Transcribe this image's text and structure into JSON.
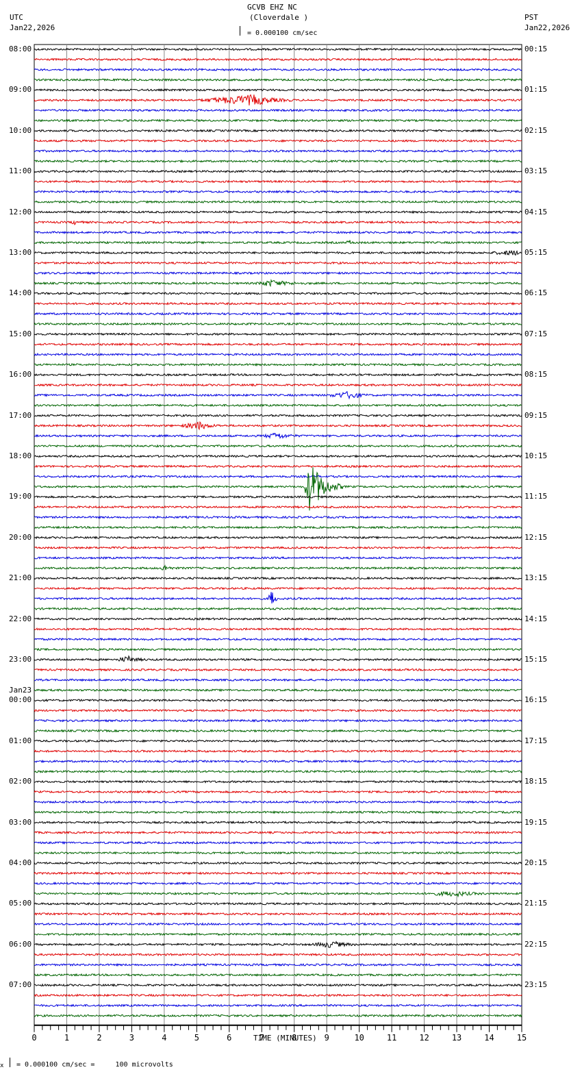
{
  "header": {
    "title": "GCVB EHZ NC",
    "location": "(Cloverdale )",
    "scale": "= 0.000100 cm/sec",
    "left_tz": "UTC",
    "left_date": "Jan22,2026",
    "right_tz": "PST",
    "right_date": "Jan22,2026"
  },
  "footer": {
    "scale_note": "= 0.000100 cm/sec =     100 microvolts",
    "scale_prefix": "x"
  },
  "chart_data": {
    "type": "line",
    "title": "GCVB EHZ NC (Cloverdale )",
    "xlabel": "TIME (MINUTES)",
    "xlim": [
      0,
      15
    ],
    "x_ticks": [
      "0",
      "1",
      "2",
      "3",
      "4",
      "5",
      "6",
      "7",
      "8",
      "9",
      "10",
      "11",
      "12",
      "13",
      "14",
      "15"
    ],
    "grid": true,
    "traces_per_hour": 4,
    "trace_colors": [
      "#000000",
      "#e00000",
      "#0000e0",
      "#006400"
    ],
    "utc_labels": [
      "08:00",
      "09:00",
      "10:00",
      "11:00",
      "12:00",
      "13:00",
      "14:00",
      "15:00",
      "16:00",
      "17:00",
      "18:00",
      "19:00",
      "20:00",
      "21:00",
      "22:00",
      "23:00",
      "00:00",
      "01:00",
      "02:00",
      "03:00",
      "04:00",
      "05:00",
      "06:00",
      "07:00"
    ],
    "date_change_label": "Jan23",
    "pst_labels": [
      "00:15",
      "01:15",
      "02:15",
      "03:15",
      "04:15",
      "05:15",
      "06:15",
      "07:15",
      "08:15",
      "09:15",
      "10:15",
      "11:15",
      "12:15",
      "13:15",
      "14:15",
      "15:15",
      "16:15",
      "17:15",
      "18:15",
      "19:15",
      "20:15",
      "21:15",
      "22:15",
      "23:15"
    ],
    "events": [
      {
        "trace": 5,
        "start": 5.0,
        "peak": 6.8,
        "end": 8.0,
        "amp": 7
      },
      {
        "trace": 17,
        "start": 1.1,
        "peak": 1.3,
        "end": 1.5,
        "amp": 3
      },
      {
        "trace": 19,
        "start": 9.6,
        "peak": 9.7,
        "end": 9.9,
        "amp": 3
      },
      {
        "trace": 20,
        "start": 14.0,
        "peak": 14.8,
        "end": 15.0,
        "amp": 3
      },
      {
        "trace": 23,
        "start": 6.8,
        "peak": 7.3,
        "end": 8.5,
        "amp": 4
      },
      {
        "trace": 34,
        "start": 9.0,
        "peak": 9.8,
        "end": 10.3,
        "amp": 5
      },
      {
        "trace": 38,
        "start": 7.0,
        "peak": 7.5,
        "end": 8.2,
        "amp": 4
      },
      {
        "trace": 37,
        "start": 4.5,
        "peak": 5.1,
        "end": 5.8,
        "amp": 5
      },
      {
        "trace": 43,
        "start": 8.3,
        "peak": 8.5,
        "end": 9.5,
        "amp": 40
      },
      {
        "trace": 51,
        "start": 3.9,
        "peak": 4.0,
        "end": 4.3,
        "amp": 5
      },
      {
        "trace": 54,
        "start": 7.2,
        "peak": 7.3,
        "end": 7.5,
        "amp": 16
      },
      {
        "trace": 60,
        "start": 2.5,
        "peak": 2.9,
        "end": 3.5,
        "amp": 4
      },
      {
        "trace": 83,
        "start": 12.0,
        "peak": 13.0,
        "end": 14.0,
        "amp": 3
      },
      {
        "trace": 88,
        "start": 8.5,
        "peak": 9.2,
        "end": 10.0,
        "amp": 4
      }
    ]
  }
}
